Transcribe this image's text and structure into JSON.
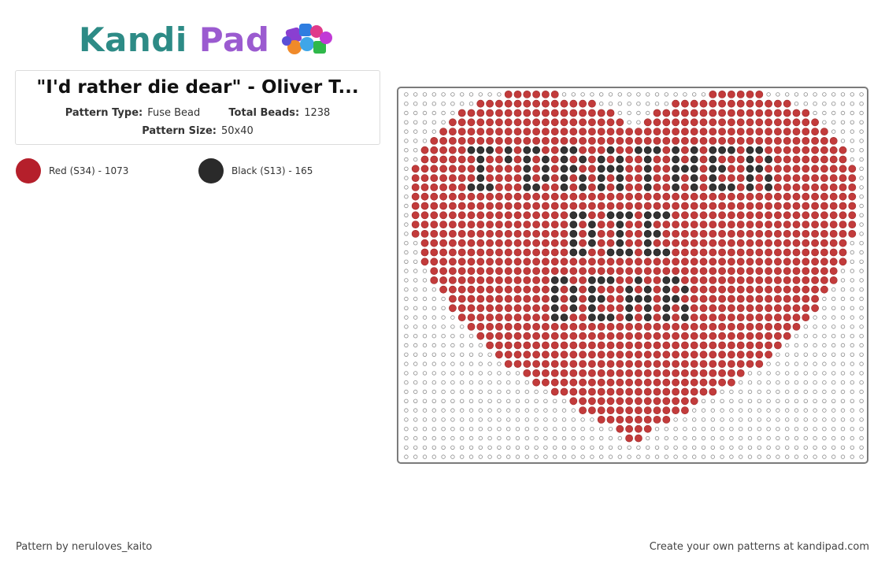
{
  "brand": {
    "kandi": "Kandi",
    "pad": "Pad"
  },
  "pattern": {
    "title": "\"I'd rather die dear\" - Oliver T...",
    "type_label": "Pattern Type:",
    "type_value": "Fuse Bead",
    "beads_label": "Total Beads:",
    "beads_value": "1238",
    "size_label": "Pattern Size:",
    "size_value": "50x40"
  },
  "colors": [
    {
      "label": "Red (S34) - 1073",
      "hex": "#b51f2b"
    },
    {
      "label": "Black (S13) - 165",
      "hex": "#2a2a2a"
    }
  ],
  "board": {
    "columns": 50,
    "rows": 40,
    "bead_red": "#c23b3b",
    "bead_black": "#333333",
    "bead_empty": "#ffffff"
  },
  "footer": {
    "credit": "Pattern by neruloves_kaito",
    "cta": "Create your own patterns at kandipad.com"
  }
}
